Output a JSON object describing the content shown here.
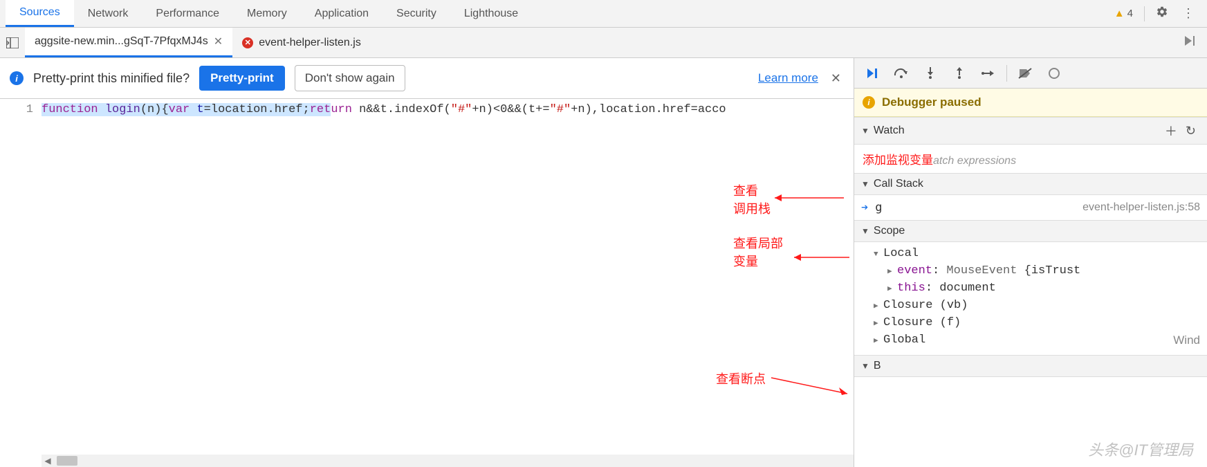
{
  "tabs": [
    "Sources",
    "Network",
    "Performance",
    "Memory",
    "Application",
    "Security",
    "Lighthouse"
  ],
  "active_tab": 0,
  "warnings_count": "4",
  "file_tabs": [
    {
      "label": "aggsite-new.min...gSqT-7PfqxMJ4s",
      "closable": true,
      "error": false,
      "active": true
    },
    {
      "label": "event-helper-listen.js",
      "closable": false,
      "error": true,
      "active": false
    }
  ],
  "pretty": {
    "message": "Pretty-print this minified file?",
    "primary": "Pretty-print",
    "secondary": "Don't show again",
    "learn": "Learn more"
  },
  "code": {
    "line_no": "1",
    "tokens": [
      {
        "t": "function ",
        "c": "kw hl"
      },
      {
        "t": "login",
        "c": "fn hl"
      },
      {
        "t": "(n){",
        "c": "op hl"
      },
      {
        "t": "var ",
        "c": "kw hl"
      },
      {
        "t": "t",
        "c": "var hl"
      },
      {
        "t": "=location.href;",
        "c": "op hl"
      },
      {
        "t": "ret",
        "c": "kw hl"
      },
      {
        "t": "urn ",
        "c": "kw"
      },
      {
        "t": "n&&t.indexOf(",
        "c": "op"
      },
      {
        "t": "\"#\"",
        "c": "str"
      },
      {
        "t": "+n)<0&&(t+=",
        "c": "op"
      },
      {
        "t": "\"#\"",
        "c": "str"
      },
      {
        "t": "+n),location.href=acco",
        "c": "op"
      }
    ]
  },
  "annotations": {
    "watch": "添加监视变量",
    "callstack_l1": "查看",
    "callstack_l2": "调用栈",
    "scope_l1": "查看局部",
    "scope_l2": "变量",
    "breakpoints": "查看断点"
  },
  "debugger": {
    "paused": "Debugger paused",
    "watch_header": "Watch",
    "watch_placeholder": "atch expressions",
    "callstack_header": "Call Stack",
    "stack_frame": {
      "name": "g",
      "location": "event-helper-listen.js:58"
    },
    "scope_header": "Scope",
    "scope": {
      "local": "Local",
      "event_key": "event",
      "event_sep": ": ",
      "event_type": "MouseEvent ",
      "event_val": "{isTrust",
      "this_key": "this",
      "this_sep": ": ",
      "this_val": "document",
      "closure1": "Closure (vb)",
      "closure2": "Closure (f)",
      "global": "Global",
      "global_val": "Wind"
    },
    "breakpoints_header": "B"
  },
  "watermark": "头条@IT管理局"
}
